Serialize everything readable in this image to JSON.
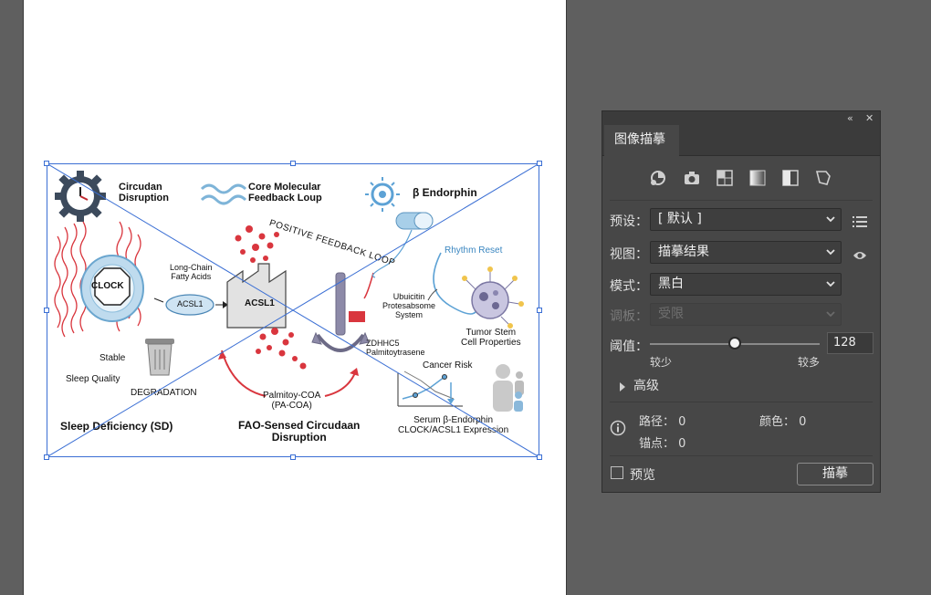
{
  "figure": {
    "circadian_disruption": "Circudan\nDisruption",
    "core_molecular": "Core Molecular\nFeedback Loup",
    "beta_endorphin": "β Endorphin",
    "positive_feedback_loop": "POSITIVE FEEDBACK LOOP",
    "rhythm_reset": "Rhythm Reset",
    "long_chain": "Long-Chain\nFatty Acids",
    "clock": "CLOCK",
    "acsl1_small": "ACSL1",
    "acsl1_factory": "ACSL1",
    "ubuicitin": "Ubuicitin\nProtesabsome\nSystem",
    "tumor_stem": "Tumor Stem\nCell Properties",
    "stable": "Stable",
    "sleep_quality": "Sleep Quality",
    "degradation": "DEGRADATION",
    "zdhhc5": "ZDHHC5\nPalmitoytrasene",
    "cancer_risk": "Cancer Risk",
    "palmitoy": "Palmitoy-COA\n(PA-COA)",
    "sleep_deficiency": "Sleep Deficiency (SD)",
    "fao_sensed": "FAO-Sensed Circudaan\nDisruption",
    "serum": "Serum β-Endorphin\nCLOCK/ACSL1 Expression"
  },
  "panel": {
    "tab_title": "图像描摹",
    "collapse_icon": "double-chevron-left-icon",
    "close_icon": "close-icon",
    "preset_label": "预设：",
    "preset_value": "[ 默认 ]",
    "view_label": "视图：",
    "view_value": "描摹结果",
    "mode_label": "模式：",
    "mode_value": "黑白",
    "palette_label": "调板：",
    "palette_value": "受限",
    "threshold_label": "阈值：",
    "threshold_value": "128",
    "threshold_min": "较少",
    "threshold_max": "较多",
    "threshold_fraction": 0.5,
    "advanced_label": "高级",
    "paths_label": "路径：",
    "paths_value": "0",
    "colors_label": "颜色：",
    "colors_value": "0",
    "anchors_label": "锚点：",
    "anchors_value": "0",
    "preview_label": "预览",
    "trace_button": "描摹"
  },
  "colors": {
    "panel_bg": "#474747",
    "selection": "#3b6fd4",
    "accent_red": "#d9363e",
    "accent_blue": "#5da2d5"
  }
}
